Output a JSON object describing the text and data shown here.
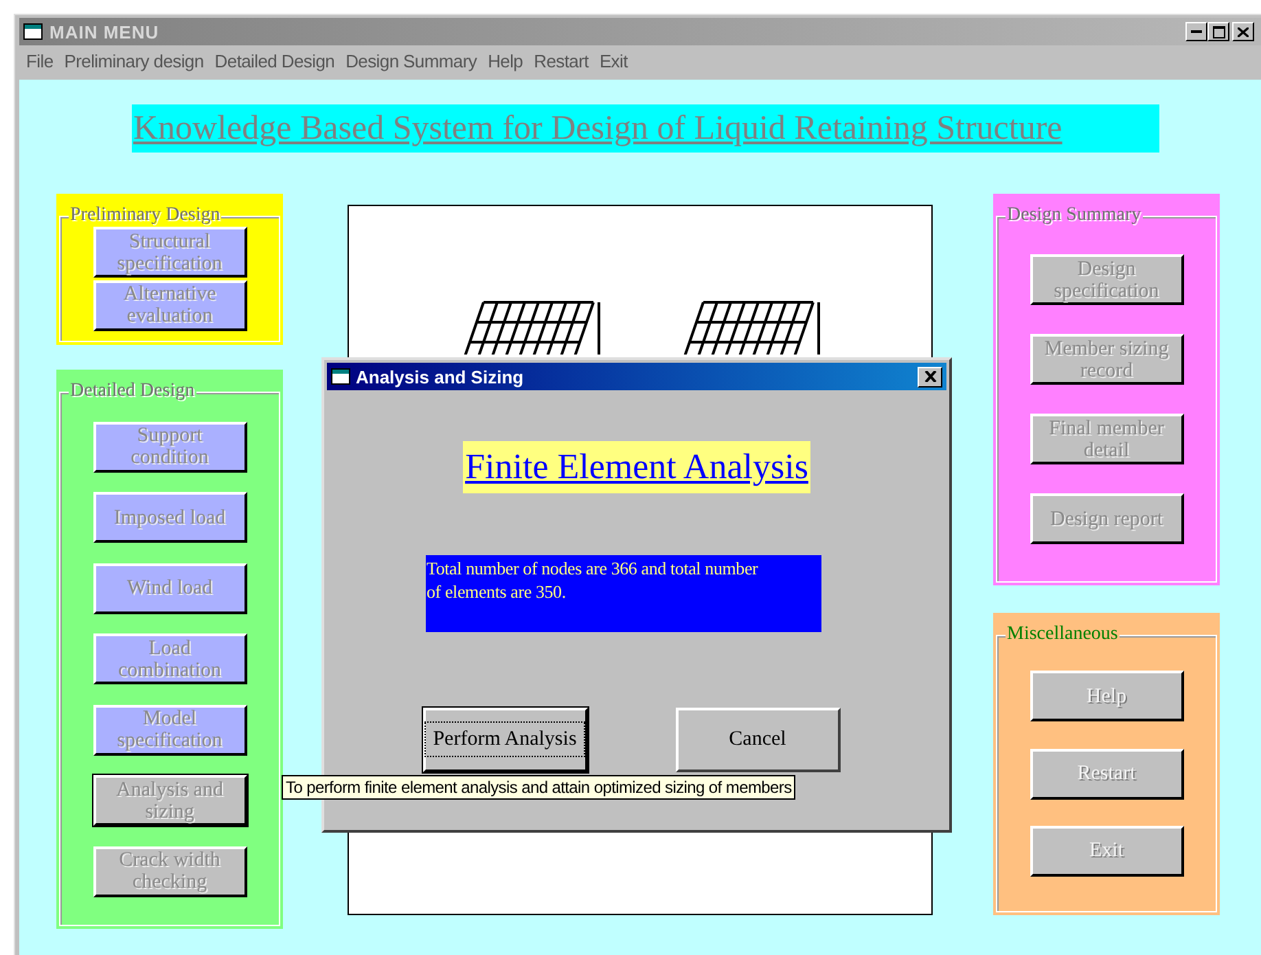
{
  "window": {
    "title": "MAIN MENU",
    "active": false
  },
  "menu": [
    {
      "label": "File"
    },
    {
      "label": "Preliminary design"
    },
    {
      "label": "Detailed Design"
    },
    {
      "label": "Design Summary"
    },
    {
      "label": "Help"
    },
    {
      "label": "Restart"
    },
    {
      "label": "Exit"
    }
  ],
  "heading": "Knowledge Based System for Design of Liquid Retaining Structure",
  "left_groups": [
    {
      "title": "Preliminary Design",
      "color": "#ffff00",
      "disabled": true,
      "buttons": [
        {
          "label": "Structural specification",
          "completed": true,
          "focused": false
        },
        {
          "label": "Alternative evaluation",
          "completed": true,
          "focused": false
        }
      ]
    },
    {
      "title": "Detailed Design",
      "color": "#80ff80",
      "disabled": true,
      "buttons": [
        {
          "label": "Support condition",
          "completed": true,
          "focused": false
        },
        {
          "label": "Imposed load",
          "completed": true,
          "focused": false
        },
        {
          "label": "Wind load",
          "completed": true,
          "focused": false
        },
        {
          "label": "Load combination",
          "completed": true,
          "focused": false
        },
        {
          "label": "Model specification",
          "completed": true,
          "focused": false
        },
        {
          "label": "Analysis and sizing",
          "completed": false,
          "focused": true
        },
        {
          "label": "Crack width checking",
          "completed": false,
          "focused": false
        }
      ]
    }
  ],
  "right_groups": [
    {
      "title": "Design Summary",
      "color": "#ff80ff",
      "disabled": true,
      "buttons": [
        {
          "label": "Design specification",
          "completed": false,
          "focused": false
        },
        {
          "label": "Member sizing record",
          "completed": false,
          "focused": false
        },
        {
          "label": "Final member detail",
          "completed": false,
          "focused": false
        },
        {
          "label": "Design report",
          "completed": false,
          "focused": false
        }
      ]
    },
    {
      "title": "Miscellaneous",
      "color": "#ffc080",
      "disabled": false,
      "buttons": [
        {
          "label": "Help",
          "completed": false,
          "focused": false
        },
        {
          "label": "Restart",
          "completed": false,
          "focused": false
        },
        {
          "label": "Exit",
          "completed": false,
          "focused": false
        }
      ]
    }
  ],
  "dialog": {
    "title": "Analysis and Sizing",
    "active": true,
    "heading": "Finite Element Analysis",
    "message": "Total number of nodes are 366 and total number of elements are 350.",
    "buttons": [
      {
        "label": "Perform Analysis",
        "focused": true
      },
      {
        "label": "Cancel",
        "focused": false
      }
    ]
  },
  "tooltip": "To perform finite element analysis and attain optimized sizing of members"
}
